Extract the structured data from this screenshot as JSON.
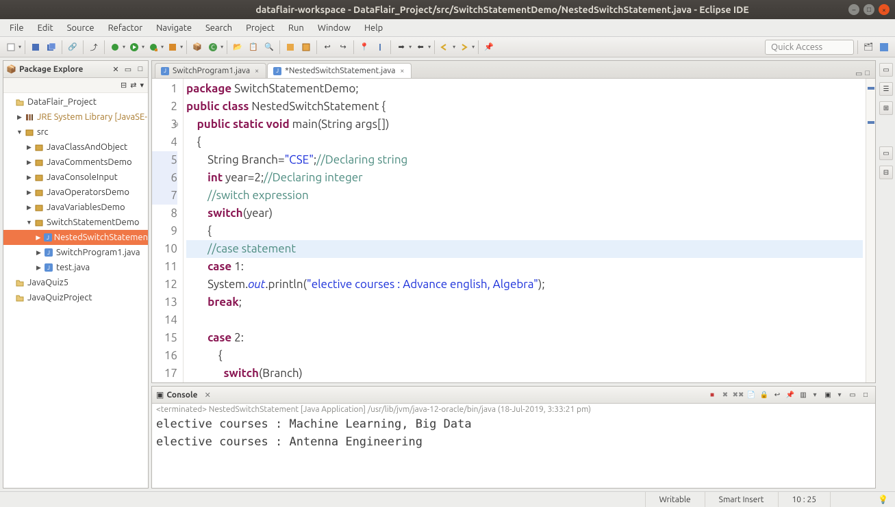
{
  "window": {
    "title": "dataflair-workspace - DataFlair_Project/src/SwitchStatementDemo/NestedSwitchStatement.java - Eclipse IDE"
  },
  "menu": {
    "items": [
      "File",
      "Edit",
      "Source",
      "Refactor",
      "Navigate",
      "Search",
      "Project",
      "Run",
      "Window",
      "Help"
    ]
  },
  "quick_access": {
    "label": "Quick Access"
  },
  "pkg_explorer": {
    "title": "Package Explore",
    "nodes": [
      {
        "depth": 0,
        "tw": "",
        "icon": "📁",
        "label": "DataFlair_Project",
        "sel": false
      },
      {
        "depth": 1,
        "tw": "▶",
        "icon": "📚",
        "label": "JRE System Library [JavaSE-",
        "sel": false,
        "lib": true
      },
      {
        "depth": 1,
        "tw": "▼",
        "icon": "📦",
        "label": "src",
        "sel": false
      },
      {
        "depth": 2,
        "tw": "▶",
        "icon": "📦",
        "label": "JavaClassAndObject",
        "sel": false
      },
      {
        "depth": 2,
        "tw": "▶",
        "icon": "📦",
        "label": "JavaCommentsDemo",
        "sel": false
      },
      {
        "depth": 2,
        "tw": "▶",
        "icon": "📦",
        "label": "JavaConsoleInput",
        "sel": false
      },
      {
        "depth": 2,
        "tw": "▶",
        "icon": "📦",
        "label": "JavaOperatorsDemo",
        "sel": false
      },
      {
        "depth": 2,
        "tw": "▶",
        "icon": "📦",
        "label": "JavaVariablesDemo",
        "sel": false
      },
      {
        "depth": 2,
        "tw": "▼",
        "icon": "📦",
        "label": "SwitchStatementDemo",
        "sel": false
      },
      {
        "depth": 3,
        "tw": "▶",
        "icon": "J",
        "label": "NestedSwitchStatemen",
        "sel": true
      },
      {
        "depth": 3,
        "tw": "▶",
        "icon": "J",
        "label": "SwitchProgram1.java",
        "sel": false
      },
      {
        "depth": 3,
        "tw": "▶",
        "icon": "J",
        "label": "test.java",
        "sel": false
      },
      {
        "depth": 0,
        "tw": "",
        "icon": "📁",
        "label": "JavaQuiz5",
        "sel": false
      },
      {
        "depth": 0,
        "tw": "",
        "icon": "📁",
        "label": "JavaQuizProject",
        "sel": false
      }
    ]
  },
  "editor": {
    "tabs": [
      {
        "label": "SwitchProgram1.java",
        "active": false,
        "dirty": false
      },
      {
        "label": "*NestedSwitchStatement.java",
        "active": true,
        "dirty": true
      }
    ],
    "lines": [
      {
        "n": 1,
        "mod": false,
        "hl": false,
        "raw": "package SwitchStatementDemo;"
      },
      {
        "n": 2,
        "mod": false,
        "hl": false,
        "raw": "public class NestedSwitchStatement {"
      },
      {
        "n": 3,
        "mod": false,
        "hl": false,
        "raw": "    public static void main(String args[])",
        "fold": true
      },
      {
        "n": 4,
        "mod": false,
        "hl": false,
        "raw": "    {"
      },
      {
        "n": 5,
        "mod": true,
        "hl": false,
        "raw": "        String Branch=\"CSE\";//Declaring string"
      },
      {
        "n": 6,
        "mod": true,
        "hl": false,
        "raw": "        int year=2;//Declaring integer"
      },
      {
        "n": 7,
        "mod": true,
        "hl": false,
        "raw": "        //switch expression"
      },
      {
        "n": 8,
        "mod": false,
        "hl": false,
        "raw": "        switch(year)"
      },
      {
        "n": 9,
        "mod": false,
        "hl": false,
        "raw": "        {"
      },
      {
        "n": 10,
        "mod": false,
        "hl": true,
        "raw": "        //case statement"
      },
      {
        "n": 11,
        "mod": false,
        "hl": false,
        "raw": "        case 1:"
      },
      {
        "n": 12,
        "mod": false,
        "hl": false,
        "raw": "        System.out.println(\"elective courses : Advance english, Algebra\");"
      },
      {
        "n": 13,
        "mod": false,
        "hl": false,
        "raw": "        break;"
      },
      {
        "n": 14,
        "mod": false,
        "hl": false,
        "raw": ""
      },
      {
        "n": 15,
        "mod": false,
        "hl": false,
        "raw": "        case 2:"
      },
      {
        "n": 16,
        "mod": false,
        "hl": false,
        "raw": "            {"
      },
      {
        "n": 17,
        "mod": false,
        "hl": false,
        "raw": "              switch(Branch)"
      }
    ]
  },
  "console": {
    "title": "Console",
    "info": "<terminated> NestedSwitchStatement [Java Application] /usr/lib/jvm/java-12-oracle/bin/java (18-Jul-2019, 3:33:21 pm)",
    "output": "elective courses : Machine Learning, Big Data\nelective courses : Antenna Engineering"
  },
  "status": {
    "writable": "Writable",
    "insert": "Smart Insert",
    "pos": "10 : 25"
  }
}
